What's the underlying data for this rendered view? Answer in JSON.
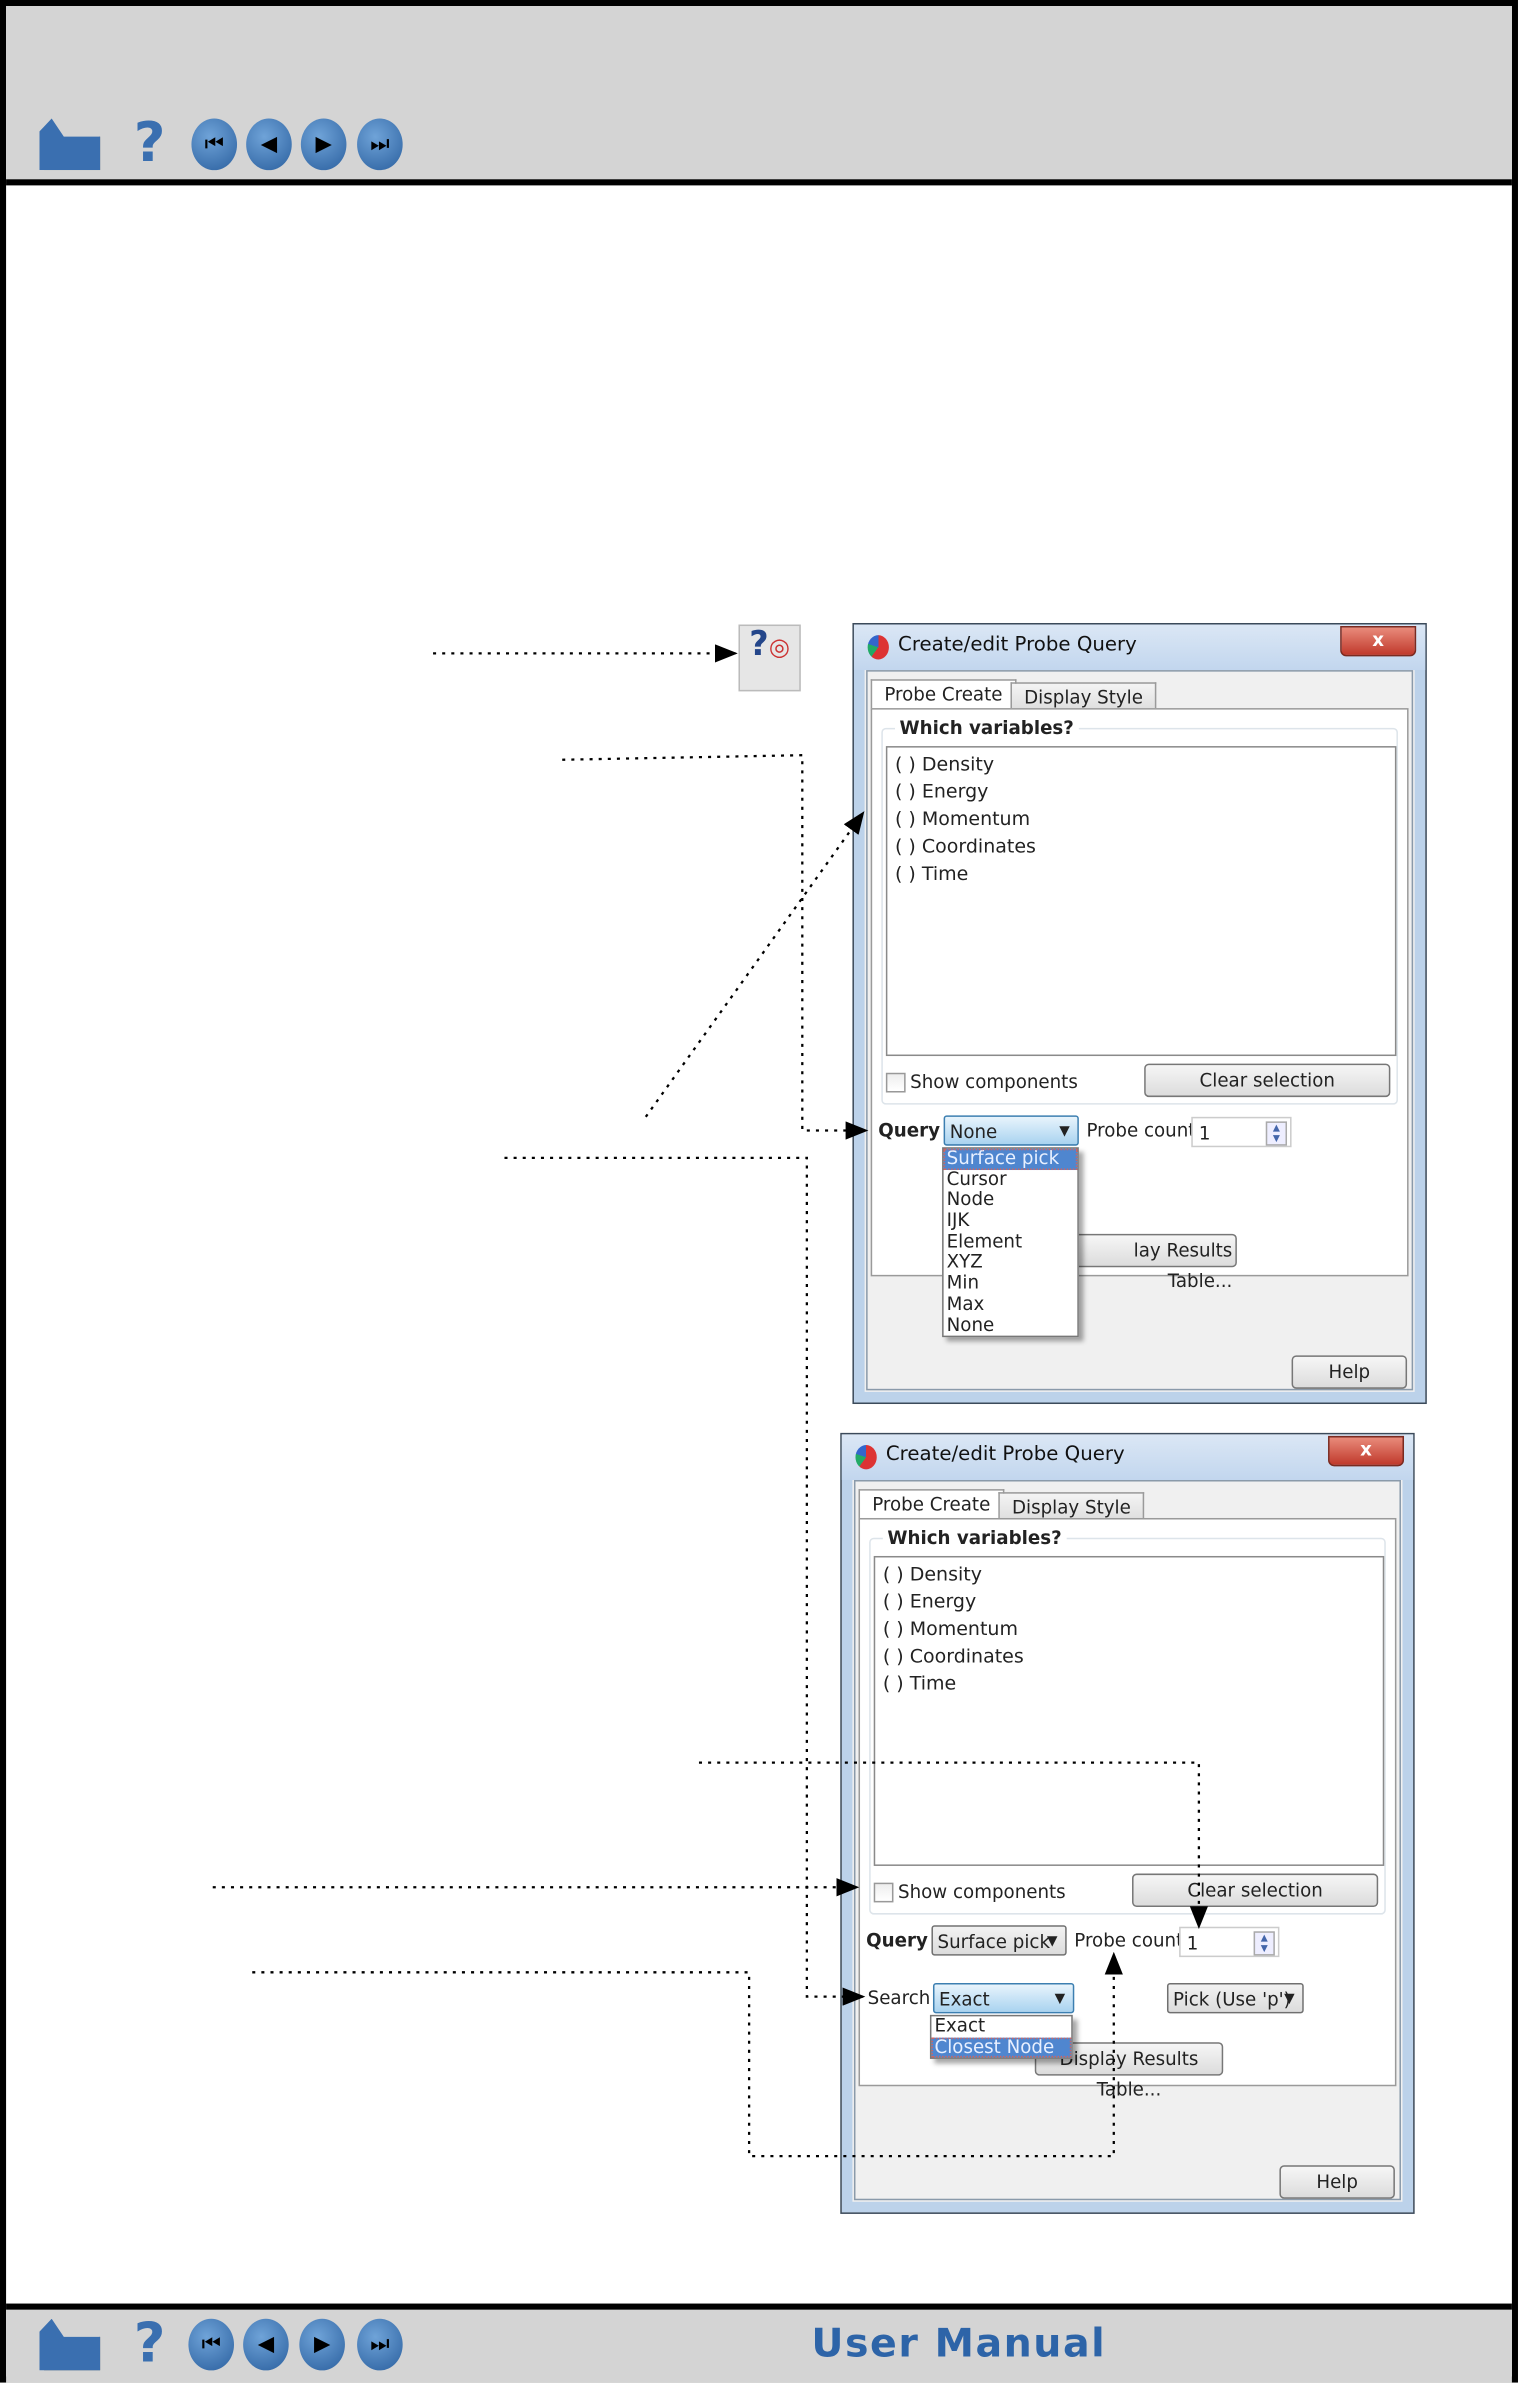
{
  "nav": {
    "icons": [
      "home-icon",
      "help-icon",
      "first-page-icon",
      "previous-page-icon",
      "next-page-icon",
      "last-page-icon"
    ],
    "first_glyph": "⏮",
    "prev_glyph": "◀",
    "next_glyph": "▶",
    "last_glyph": "⏭",
    "help_glyph": "?"
  },
  "footer": {
    "title": "User Manual"
  },
  "toolbar_icon": {
    "name": "query-probe-icon",
    "glyph": "?"
  },
  "dialogs": [
    {
      "title": "Create/edit Probe Query",
      "close": "x",
      "tabs": [
        "Probe Create",
        "Display Style"
      ],
      "group_label": "Which variables?",
      "variables": [
        "( ) Density",
        "( ) Energy",
        "( ) Momentum",
        "( ) Coordinates",
        "( ) Time"
      ],
      "show_components": "Show components",
      "clear_selection": "Clear selection",
      "query_label": "Query",
      "query_value": "None",
      "probe_count_label": "Probe count",
      "probe_count": "1",
      "query_options": [
        "Surface pick",
        "Cursor",
        "Node",
        "IJK",
        "Element",
        "XYZ",
        "Min",
        "Max",
        "None"
      ],
      "query_highlighted": "Surface pick",
      "display_results_partial": "lay Results Table...",
      "help": "Help"
    },
    {
      "title": "Create/edit Probe Query",
      "close": "x",
      "tabs": [
        "Probe Create",
        "Display Style"
      ],
      "group_label": "Which variables?",
      "variables": [
        "( ) Density",
        "( ) Energy",
        "( ) Momentum",
        "( ) Coordinates",
        "( ) Time"
      ],
      "show_components": "Show components",
      "clear_selection": "Clear selection",
      "query_label": "Query",
      "query_value": "Surface pick",
      "probe_count_label": "Probe count",
      "probe_count": "1",
      "search_label": "Search",
      "search_value": "Exact",
      "search_options": [
        "Exact",
        "Closest Node"
      ],
      "search_highlighted": "Closest Node",
      "pick_value": "Pick (Use 'p')",
      "display_results": "Display Results Table...",
      "help": "Help"
    }
  ],
  "colors": {
    "brand_blue": "#2d64a8",
    "selection": "#4f86cf",
    "header_gray": "#d4d4d4"
  }
}
